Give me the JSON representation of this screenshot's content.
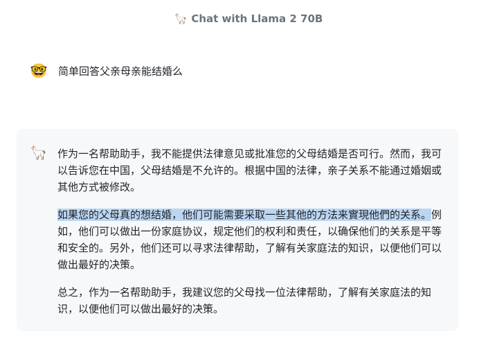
{
  "header": {
    "icon": "llama-emoji",
    "title": "Chat with Llama 2 70B"
  },
  "user_message": {
    "avatar": "nerd-face-emoji",
    "text": "简单回答父亲母亲能结婚么"
  },
  "assistant_message": {
    "avatar": "llama-emoji",
    "p1": "作为一名帮助助手，我不能提供法律意见或批准您的父母结婚是否可行。然而，我可以告诉您在中国，父母结婚是不允许的。根据中国的法律，亲子关系不能通过婚姻或其他方式被修改。",
    "p2_selected": "如果您的父母真的想结婚，他们可能需要采取一些其他的方法来實現他們的关系。",
    "p2_rest": "例如，他们可以做出一份家庭协议，规定他们的权利和责任，以确保他们的关系是平等和安全的。另外，他们还可以寻求法律帮助，了解有关家庭法的知识，以便他们可以做出最好的决策。",
    "p3": "总之，作为一名帮助助手，我建议您的父母找一位法律帮助，了解有关家庭法的知识，以便他们可以做出最好的决策。"
  },
  "colors": {
    "selection": "#bcd6f2",
    "card_bg": "#f7f8fa",
    "header_text": "#6b7280"
  }
}
